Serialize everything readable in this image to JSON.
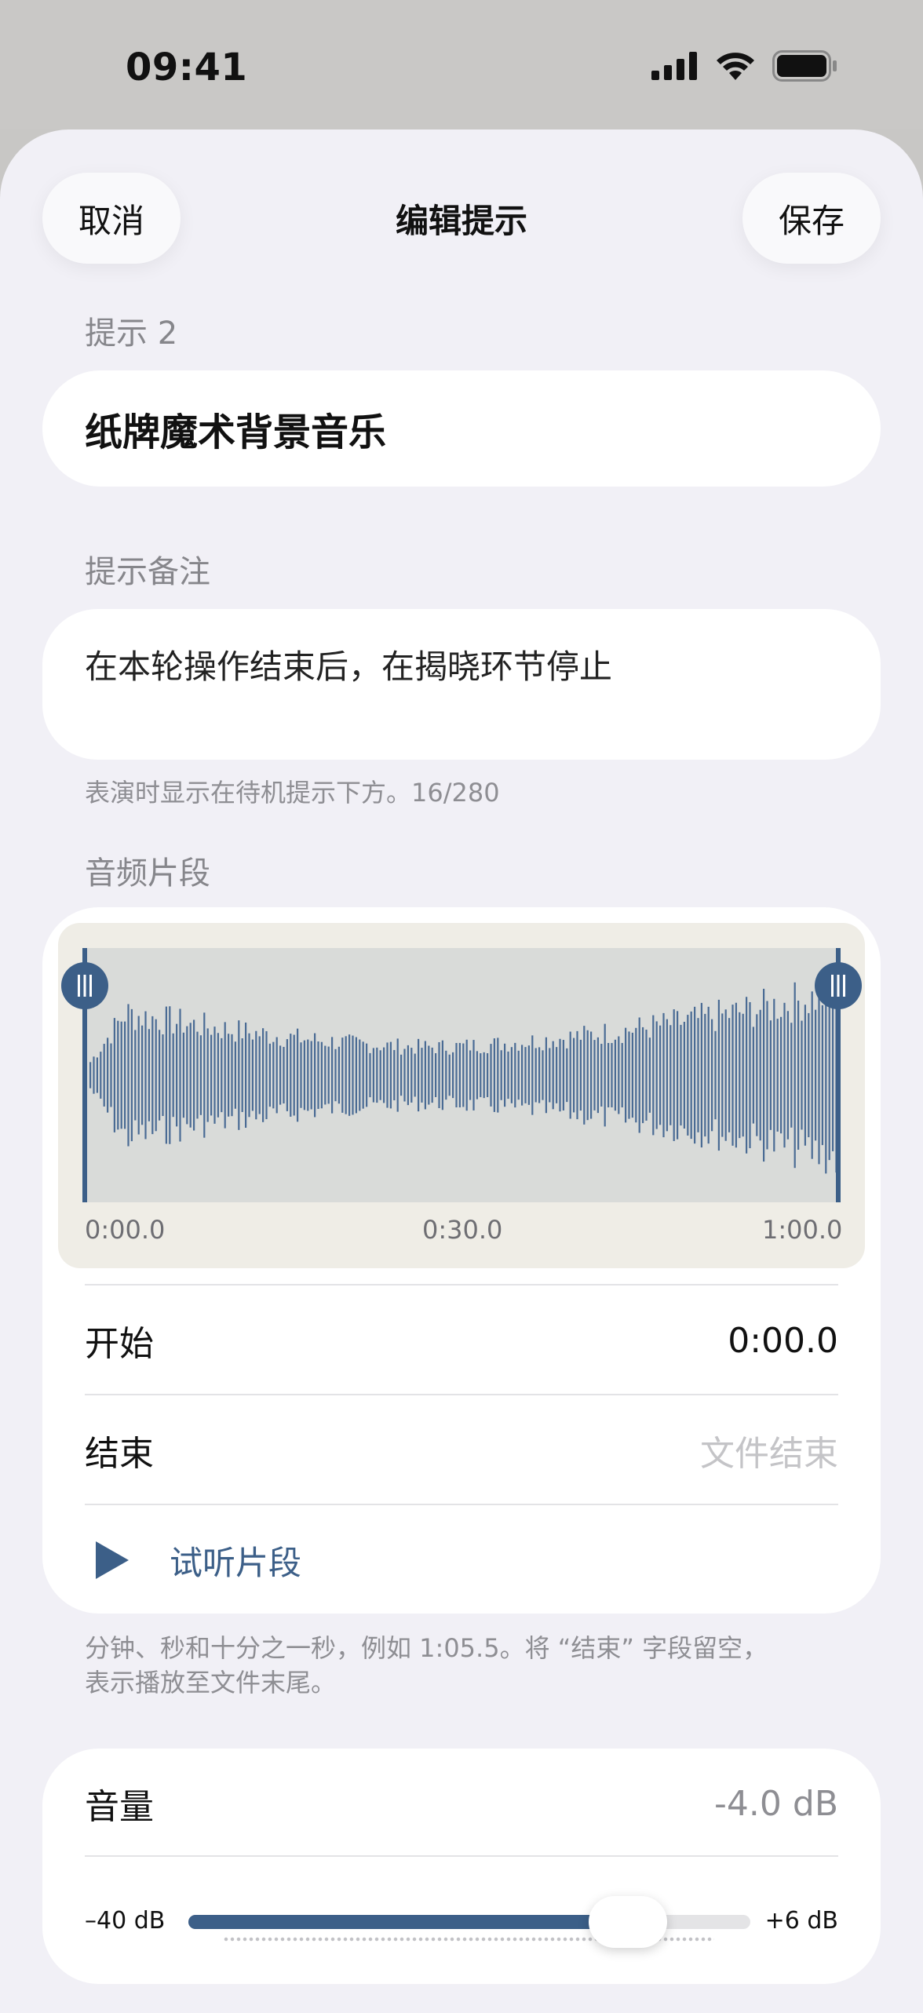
{
  "status": {
    "time": "09:41"
  },
  "nav": {
    "cancel": "取消",
    "title": "编辑提示",
    "save": "保存"
  },
  "cue": {
    "label": "提示 2",
    "name": "纸牌魔术背景音乐",
    "note_label": "提示备注",
    "note": "在本轮操作结束后，在揭晓环节停止",
    "note_hint": "表演时显示在待机提示下方。16/280"
  },
  "audio": {
    "section_label": "音频片段",
    "ticks": [
      "0:00.0",
      "0:30.0",
      "1:00.0"
    ],
    "start_label": "开始",
    "start_value": "0:00.0",
    "end_label": "结束",
    "end_placeholder": "文件结束",
    "preview_label": "试听片段",
    "hint_line1": "分钟、秒和十分之一秒，例如 1:05.5。将 “结束” 字段留空，",
    "hint_line2": "表示播放至文件末尾。",
    "trim_start_fraction": 0.0,
    "trim_end_fraction": 1.0
  },
  "volume": {
    "label": "音量",
    "value": "-4.0 dB",
    "min_label": "–40 dB",
    "max_label": "+6 dB",
    "level_db": -4.0,
    "min_db": -40,
    "max_db": 6
  },
  "colors": {
    "accent": "#3c5f88",
    "waveform": "#4a6b94",
    "sheet_bg": "#f1f0f6"
  }
}
